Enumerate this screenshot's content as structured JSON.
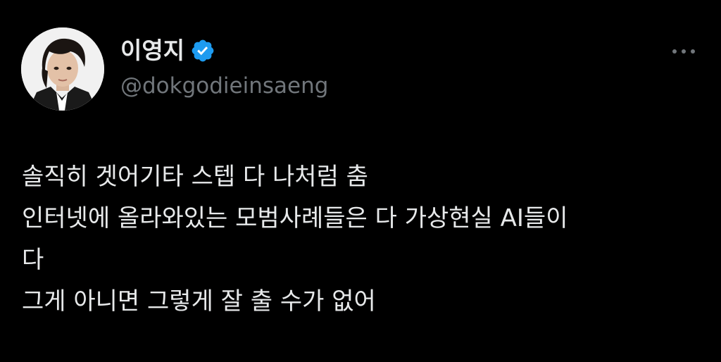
{
  "author": {
    "display_name": "이영지",
    "handle": "@dokgodieinsaeng",
    "verified": true,
    "avatar_icon": "profile-photo",
    "verified_icon": "verified-badge-icon",
    "verified_color": "#1d9bf0"
  },
  "menu": {
    "icon": "more-options-icon"
  },
  "tweet": {
    "lines": [
      "솔직히 겟어기타 스텝 다 나처럼 춤",
      "인터넷에 올라와있는 모범사례들은 다 가상현실 AI들이",
      "다",
      "그게 아니면 그렇게 잘 출 수가 없어"
    ]
  },
  "colors": {
    "background": "#000000",
    "primary_text": "#e7e9ea",
    "secondary_text": "#71767b"
  }
}
